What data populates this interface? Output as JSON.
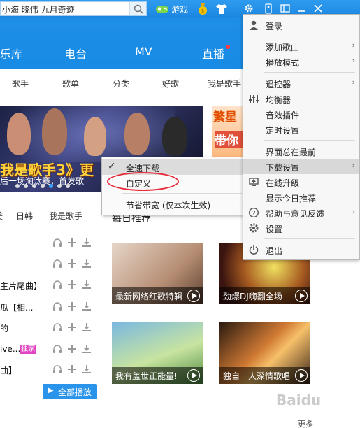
{
  "search": {
    "query": "小海 晓伟 九月奇迹"
  },
  "topbar": {
    "game_label": "游戏"
  },
  "nav": {
    "tabs": [
      "乐库",
      "电台",
      "MV",
      "直播"
    ]
  },
  "subnav": {
    "items": [
      "歌手",
      "歌单",
      "分类",
      "好歌",
      "我是歌手"
    ]
  },
  "banner": {
    "title": "我是歌手3》更",
    "subtitle": "后一场淘汰赛，首发歌"
  },
  "side_banner": {
    "line1": "繁星",
    "line2": "带你"
  },
  "list_tabs": [
    "美",
    "日韩",
    "我是歌手"
  ],
  "songs": [
    {
      "title": ""
    },
    {
      "title": ""
    },
    {
      "title": "主片尾曲】"
    },
    {
      "title": "瓜【相..."
    },
    {
      "title": "的"
    },
    {
      "title": "ive...",
      "badge": "独家"
    },
    {
      "title": "曲】"
    }
  ],
  "play_all_label": "全部播放",
  "daily": {
    "title": "每日推荐",
    "cards": [
      {
        "caption": "最新网络红歌特辑"
      },
      {
        "caption": "劲爆DJ嗨翻全场"
      },
      {
        "caption": "我有盖世正能量!"
      },
      {
        "caption": "独自一人深情歌唱"
      }
    ]
  },
  "more_label": "更多",
  "context_menu": {
    "items": [
      {
        "label": "全速下载",
        "checked": true
      },
      {
        "label": "自定义"
      },
      {
        "label": "节省带宽 (仅本次生效)"
      }
    ]
  },
  "main_menu": {
    "items": [
      {
        "label": "登录",
        "icon": "user-icon"
      },
      {
        "label": "添加歌曲",
        "submenu": true
      },
      {
        "label": "播放模式",
        "submenu": true
      },
      {
        "label": "遥控器",
        "submenu": true
      },
      {
        "label": "均衡器",
        "icon": "equalizer-icon"
      },
      {
        "label": "音效插件"
      },
      {
        "label": "定时设置"
      },
      {
        "label": "界面总在最前"
      },
      {
        "label": "下载设置",
        "submenu": true,
        "highlighted": true
      },
      {
        "label": "在线升级",
        "icon": "upgrade-icon"
      },
      {
        "label": "显示今日推荐"
      },
      {
        "label": "帮助与意见反馈",
        "icon": "help-icon",
        "submenu": true
      },
      {
        "label": "设置",
        "icon": "gear-icon"
      },
      {
        "label": "退出",
        "icon": "power-icon"
      }
    ]
  },
  "colors": {
    "header_blue": "#1a86e0",
    "highlight_red": "#e8293a",
    "badge_pink": "#e046c2"
  }
}
